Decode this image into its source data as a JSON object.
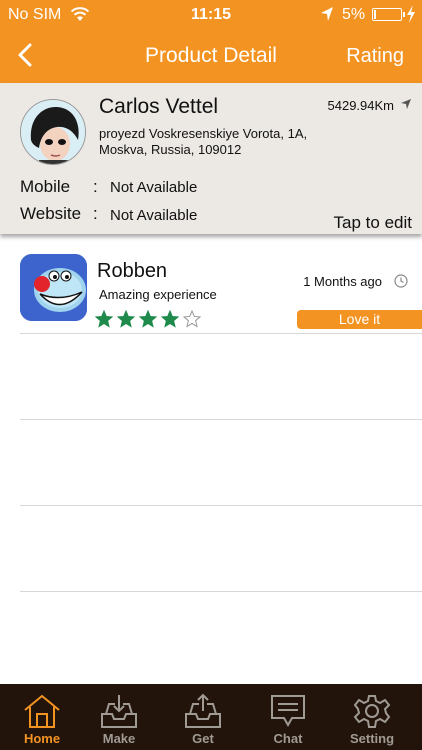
{
  "status_bar": {
    "carrier": "No SIM",
    "time": "11:15",
    "battery": "5%"
  },
  "nav": {
    "title": "Product Detail",
    "rating_label": "Rating"
  },
  "profile": {
    "name": "Carlos Vettel",
    "distance": "5429.94Km",
    "address": "proyezd Voskresenskiye Vorota, 1A, Moskva, Russia, 109012",
    "mobile_label": "Mobile",
    "mobile_value": "Not Available",
    "website_label": "Website",
    "website_value": "Not Available",
    "separator": ":",
    "tap_to_edit": "Tap to edit"
  },
  "reviews": [
    {
      "name": "Robben",
      "text": "Amazing experience",
      "time_ago": "1 Months ago",
      "rating": 4,
      "rating_max": 5,
      "badge": "Love it"
    }
  ],
  "tabs": [
    {
      "label": "Home",
      "icon": "home-icon",
      "active": true
    },
    {
      "label": "Make",
      "icon": "inbox-icon",
      "active": false
    },
    {
      "label": "Get",
      "icon": "upload-icon",
      "active": false
    },
    {
      "label": "Chat",
      "icon": "chat-icon",
      "active": false
    },
    {
      "label": "Setting",
      "icon": "gear-icon",
      "active": false
    }
  ],
  "colors": {
    "accent": "#f39322",
    "card_bg": "#ece9e4",
    "tabbar_bg": "#22140b",
    "star_fill": "#1f8a4c"
  }
}
